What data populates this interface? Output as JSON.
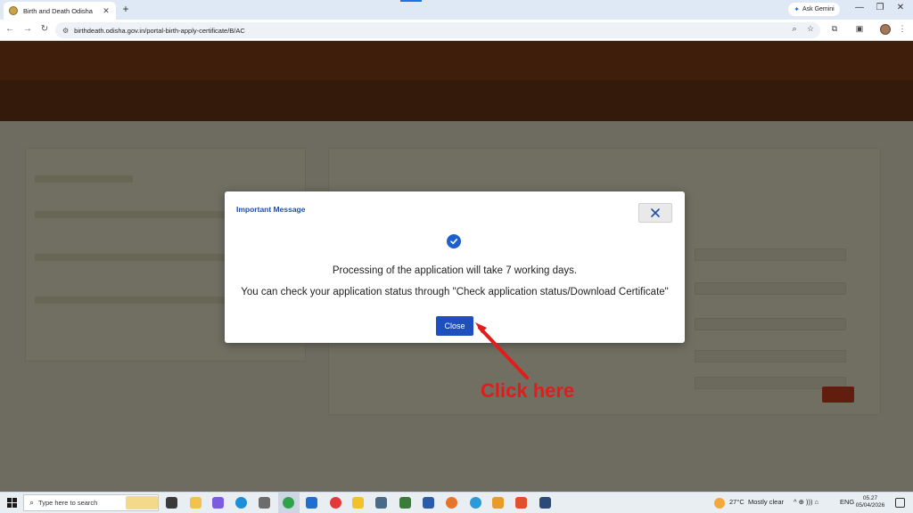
{
  "browser": {
    "tab_title": "Birth and Death Odisha",
    "tab_close": "✕",
    "new_tab": "+",
    "ask_gemini": "Ask Gemini",
    "url": "birthdeath.odisha.gov.in/portal-birth-apply-certificate/B/AC",
    "window_controls": {
      "minimize": "—",
      "restore": "❐",
      "close": "✕"
    },
    "nav": {
      "back": "←",
      "forward": "→",
      "reload": "↻"
    },
    "right_icons": {
      "zoom": "⌕",
      "bookmark": "☆",
      "extensions": "⧉",
      "sidepanel": "▣",
      "menu": "⋮"
    }
  },
  "modal": {
    "title": "Important Message",
    "message_line1": "Processing of the application will take 7 working days.",
    "message_line2": "You can check your application status through \"Check application status/Download Certificate\"",
    "close_button": "Close",
    "accent": "#1e4fbf"
  },
  "annotation": {
    "text": "Click here",
    "color": "#e31b1b"
  },
  "taskbar": {
    "search_placeholder": "Type here to search",
    "weather_temp": "27°C",
    "weather_desc": "Mostly clear",
    "lang": "ENG",
    "time": "05.27",
    "date": "05/04/2026",
    "tray_icons": "^ ⊕ ))) ⌂"
  }
}
